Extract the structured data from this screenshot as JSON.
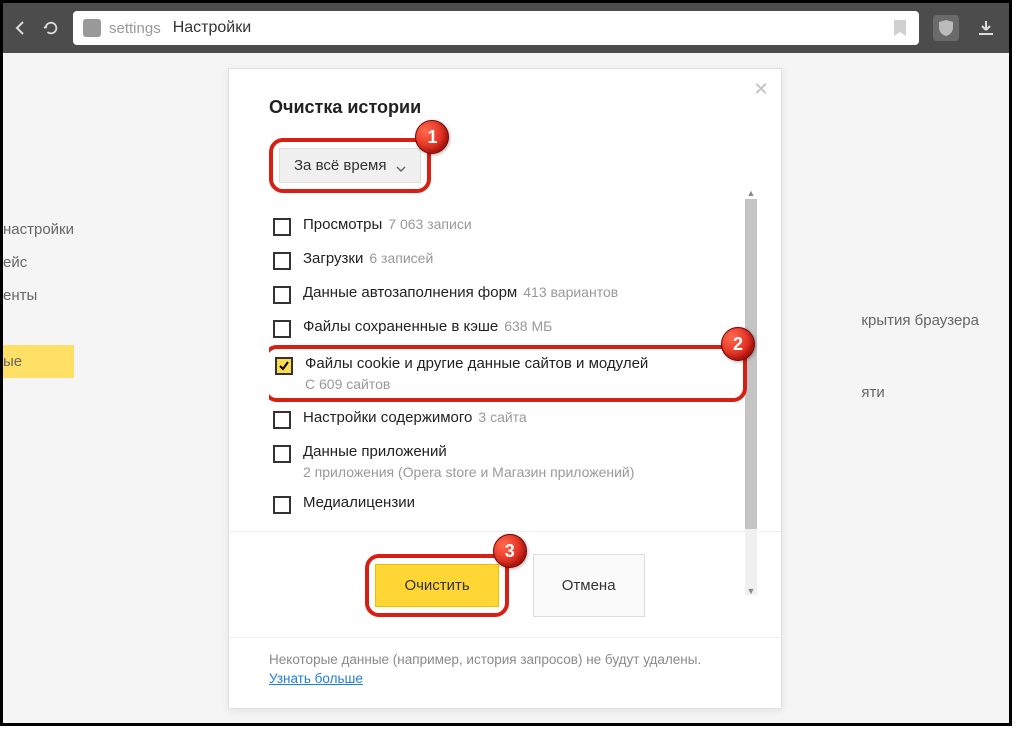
{
  "browser": {
    "addr_keyword": "settings",
    "addr_page": "Настройки"
  },
  "sidebar": {
    "items": [
      "настройки",
      "ейс",
      "енты",
      "ые"
    ],
    "right_items": [
      "крытия браузера",
      "яти"
    ]
  },
  "dialog": {
    "title": "Очистка истории",
    "time_range": "За всё время",
    "items": [
      {
        "label": "Просмотры",
        "sub": "7 063 записи",
        "checked": false
      },
      {
        "label": "Загрузки",
        "sub": "6 записей",
        "checked": false
      },
      {
        "label": "Данные автозаполнения форм",
        "sub": "413 вариантов",
        "checked": false
      },
      {
        "label": "Файлы сохраненные в кэше",
        "sub": "638 МБ",
        "checked": false
      },
      {
        "label": "Файлы cookie и другие данные сайтов и модулей",
        "sub": "С 609 сайтов",
        "checked": true,
        "multiline": true
      },
      {
        "label": "Настройки содержимого",
        "sub": "3 сайта",
        "checked": false
      },
      {
        "label": "Данные приложений",
        "sub": "2 приложения (Opera store и Магазин приложений)",
        "checked": false,
        "multiline": true
      },
      {
        "label": "Медиалицензии",
        "sub": "",
        "checked": false
      }
    ],
    "btn_primary": "Очистить",
    "btn_cancel": "Отмена",
    "footer_note": "Некоторые данные (например, история запросов) не будут удалены.",
    "footer_link": "Узнать больше"
  },
  "badges": {
    "b1": "1",
    "b2": "2",
    "b3": "3"
  }
}
